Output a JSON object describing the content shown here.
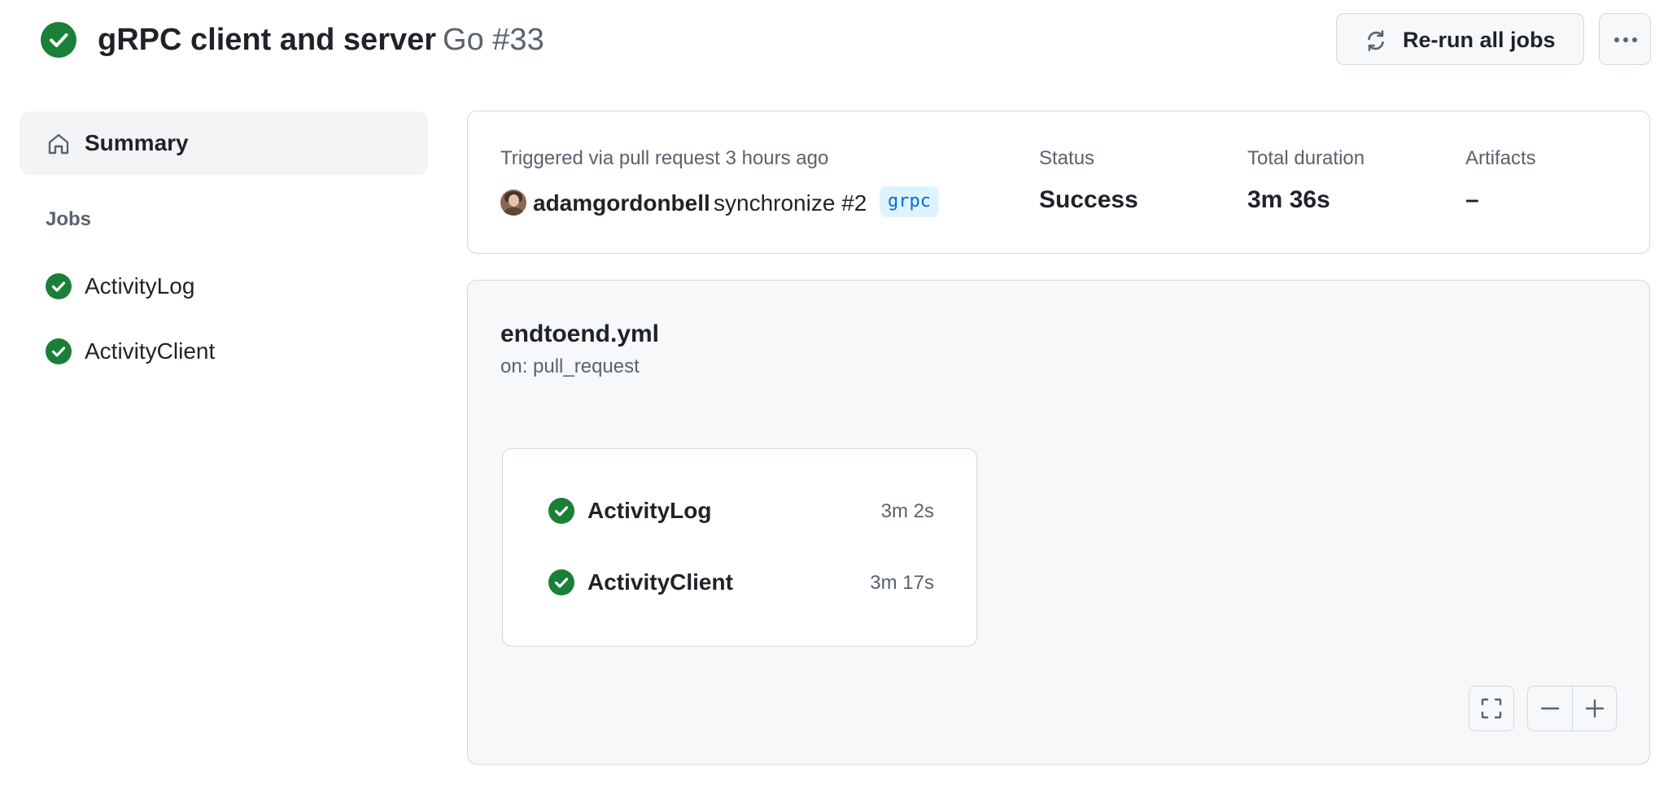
{
  "header": {
    "workflow_name": "gRPC client and server",
    "run_label": "Go #33",
    "status_icon": "check-circle-fill-icon",
    "rerun_label": "Re-run all jobs",
    "rerun_icon": "sync-icon",
    "more_icon": "kebab-horizontal-icon"
  },
  "sidebar": {
    "summary_label": "Summary",
    "summary_icon": "home-icon",
    "jobs_heading": "Jobs",
    "jobs": [
      {
        "label": "ActivityLog",
        "status": "success"
      },
      {
        "label": "ActivityClient",
        "status": "success"
      }
    ]
  },
  "summary": {
    "trigger_text": "Triggered via pull request 3 hours ago",
    "actor": "adamgordonbell",
    "event": "synchronize #2",
    "branch": "grpc",
    "status_label": "Status",
    "status_value": "Success",
    "duration_label": "Total duration",
    "duration_value": "3m 36s",
    "artifacts_label": "Artifacts",
    "artifacts_value": "–"
  },
  "workflow": {
    "file": "endtoend.yml",
    "trigger": "on: pull_request",
    "jobs": [
      {
        "label": "ActivityLog",
        "duration": "3m 2s",
        "status": "success"
      },
      {
        "label": "ActivityClient",
        "duration": "3m 17s",
        "status": "success"
      }
    ],
    "controls": [
      "fullscreen-icon",
      "zoom-out-icon",
      "zoom-in-icon"
    ]
  },
  "colors": {
    "success": "#1a7f37",
    "muted_text": "#59636e",
    "branch_bg": "#ddf4ff",
    "branch_text": "#0969da",
    "panel_bg": "#f6f8fa",
    "border": "#d1d9e0"
  }
}
